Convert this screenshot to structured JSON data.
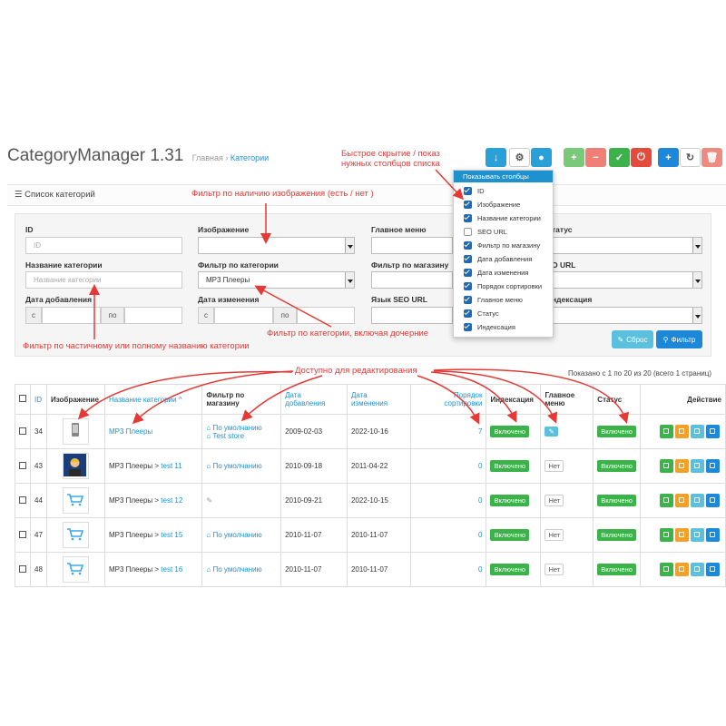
{
  "header": {
    "title": "CategoryManager 1.31",
    "breadcrumb_home": "Главная",
    "breadcrumb_sep": "›",
    "breadcrumb_current": "Категории"
  },
  "annotations": {
    "columns_hide": "Быстрое скрытие / показ",
    "columns_hide2": "нужных столбцов списка",
    "image_filter": "Фильтр по наличию изображения (есть / нет )",
    "name_filter": "Фильтр по частичному или полному названию категории",
    "category_filter": "Фильтр по категории, включая дочерние",
    "editable": "Доступно для редактирования"
  },
  "panel": {
    "title": "Список категорий"
  },
  "filter": {
    "id_label": "ID",
    "id_placeholder": "ID",
    "image_label": "Изображение",
    "mainmenu_label": "Главное меню",
    "status_label": "татус",
    "name_label": "Название категории",
    "name_placeholder": "Название категории",
    "category_label": "Фильтр по категории",
    "category_value": "MP3 Плееры",
    "store_label": "Фильтр по магазину",
    "seo_label": "O URL",
    "date_added_label": "Дата добавления",
    "date_modified_label": "Дата изменения",
    "seo_lang_label": "Язык SEO URL",
    "index_label": "ндексация",
    "from": "с",
    "to": "по",
    "reset_button": "Сброс",
    "filter_button": "Фильтр"
  },
  "columns_dropdown": {
    "header": "Показывать столбцы",
    "items": [
      {
        "label": "ID",
        "checked": true
      },
      {
        "label": "Изображение",
        "checked": true
      },
      {
        "label": "Название категории",
        "checked": true
      },
      {
        "label": "SEO URL",
        "checked": false
      },
      {
        "label": "Фильтр по магазину",
        "checked": true
      },
      {
        "label": "Дата добавления",
        "checked": true
      },
      {
        "label": "Дата изменения",
        "checked": true
      },
      {
        "label": "Порядок сортировки",
        "checked": true
      },
      {
        "label": "Главное меню",
        "checked": true
      },
      {
        "label": "Статус",
        "checked": true
      },
      {
        "label": "Индексация",
        "checked": true
      }
    ]
  },
  "pagination": {
    "shown": "Показано с 1 по 20 из 20 (всего 1 страниц)"
  },
  "table": {
    "headers": {
      "id": "ID",
      "image": "Изображение",
      "name": "Название категории",
      "sort_arrow": "^",
      "store1": "Фильтр по",
      "store2": "магазину",
      "added1": "Дата",
      "added2": "добавления",
      "modified1": "Дата",
      "modified2": "изменения",
      "sort1": "Порядок",
      "sort2": "сортировки",
      "index": "Индексация",
      "menu1": "Главное",
      "menu2": "меню",
      "status": "Статус",
      "action": "Действие"
    },
    "rows": [
      {
        "id": "34",
        "name": "MP3 Плееры",
        "sub": "",
        "store1": "По умолчанию",
        "store2": "Test store",
        "added": "2009-02-03",
        "modified": "2022-10-16",
        "sort": "7",
        "index": "Включено",
        "menu": "",
        "status": "Включено",
        "thumb": "phone"
      },
      {
        "id": "43",
        "name": "MP3 Плееры",
        "sub": "test 11",
        "store1": "По умолчанию",
        "store2": "",
        "added": "2010-09-18",
        "modified": "2011-04-22",
        "sort": "0",
        "index": "Включено",
        "menu": "Нет",
        "status": "Включено",
        "thumb": "person"
      },
      {
        "id": "44",
        "name": "MP3 Плееры",
        "sub": "test 12",
        "store1": "",
        "store2": "",
        "added": "2010-09-21",
        "modified": "2022-10-15",
        "sort": "0",
        "index": "Включено",
        "menu": "Нет",
        "status": "Включено",
        "thumb": "cart"
      },
      {
        "id": "47",
        "name": "MP3 Плееры",
        "sub": "test 15",
        "store1": "По умолчанию",
        "store2": "",
        "added": "2010-11-07",
        "modified": "2010-11-07",
        "sort": "0",
        "index": "Включено",
        "menu": "Нет",
        "status": "Включено",
        "thumb": "cart"
      },
      {
        "id": "48",
        "name": "MP3 Плееры",
        "sub": "test 16",
        "store1": "По умолчанию",
        "store2": "",
        "added": "2010-11-07",
        "modified": "2010-11-07",
        "sort": "0",
        "index": "Включено",
        "menu": "Нет",
        "status": "Включено",
        "thumb": "cart"
      }
    ],
    "sub_sep": ">"
  },
  "colors": {
    "accent": "#1e91cf",
    "annotation": "#e53935",
    "enabled": "#3cb34a"
  }
}
